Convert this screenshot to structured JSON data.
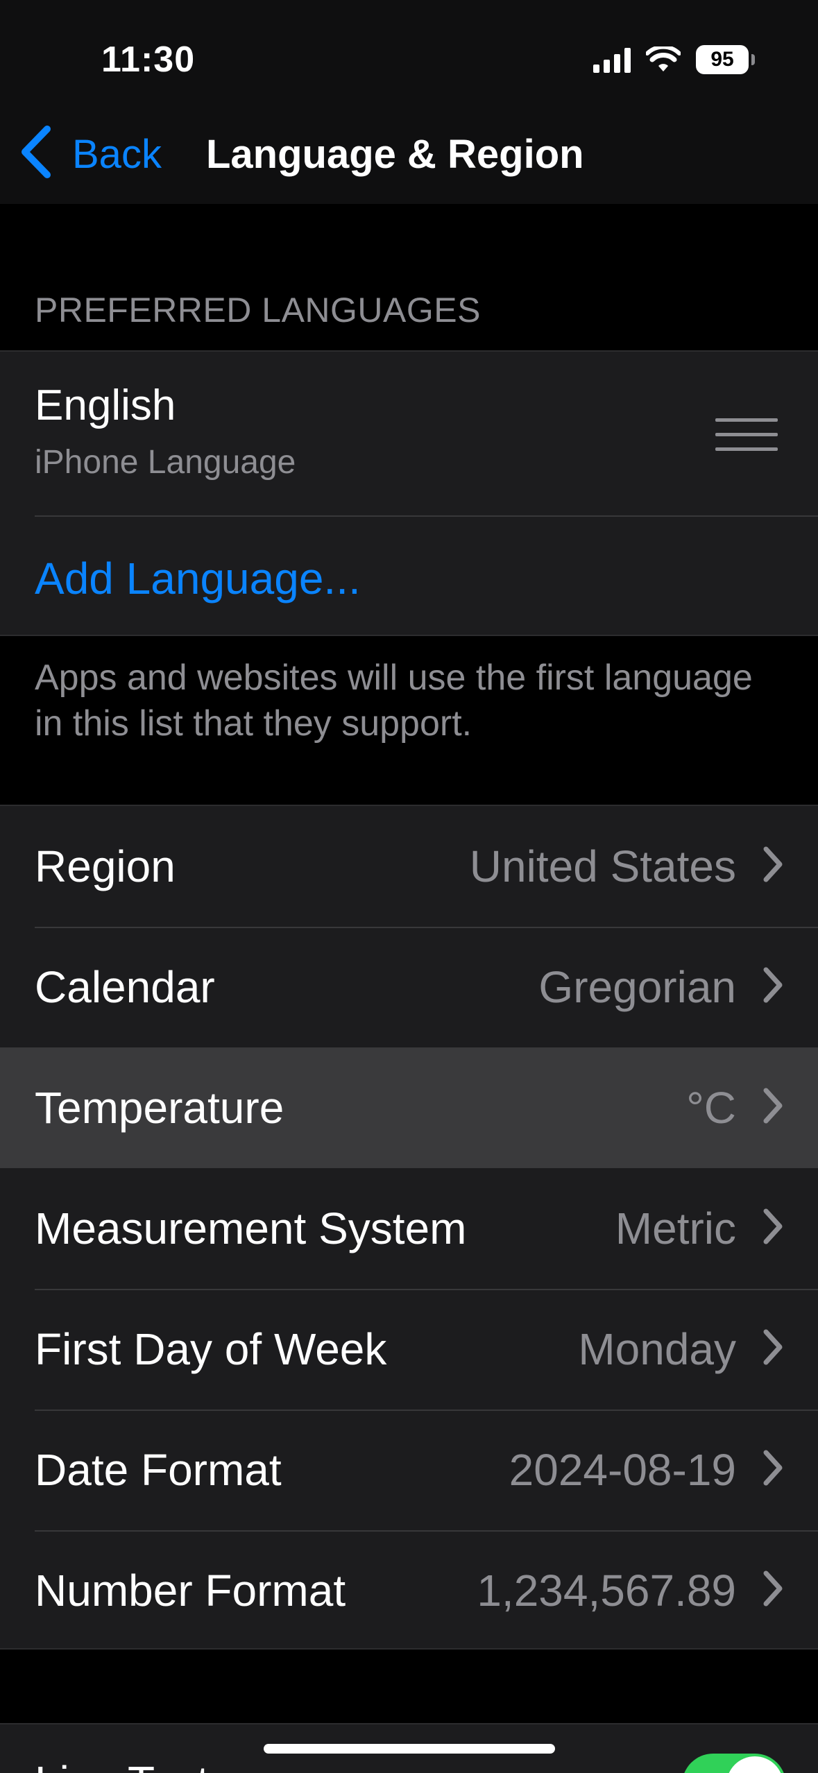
{
  "status_bar": {
    "time": "11:30",
    "battery": "95",
    "icons": [
      "cellular-signal-icon",
      "wifi-icon",
      "battery-icon"
    ]
  },
  "nav": {
    "back_label": "Back",
    "title": "Language & Region"
  },
  "preferred_languages": {
    "header": "PREFERRED LANGUAGES",
    "language_name": "English",
    "language_subtitle": "iPhone Language",
    "add_language": "Add Language...",
    "footer": "Apps and websites will use the first language in this list that they support."
  },
  "settings": {
    "rows": [
      {
        "label": "Region",
        "value": "United States"
      },
      {
        "label": "Calendar",
        "value": "Gregorian"
      },
      {
        "label": "Temperature",
        "value": "°C",
        "highlighted": true
      },
      {
        "label": "Measurement System",
        "value": "Metric"
      },
      {
        "label": "First Day of Week",
        "value": "Monday"
      },
      {
        "label": "Date Format",
        "value": "2024-08-19"
      },
      {
        "label": "Number Format",
        "value": "1,234,567.89"
      }
    ]
  },
  "live_text": {
    "label": "Live Text",
    "enabled": true
  },
  "colors": {
    "accent": "#0a84ff",
    "toggle_on": "#30d158",
    "secondary_text": "#8e8e93",
    "cell_background": "#1c1c1e",
    "highlight_background": "#3a3a3c"
  }
}
